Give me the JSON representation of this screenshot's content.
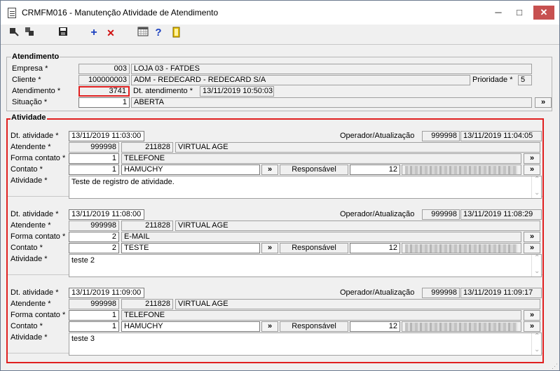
{
  "window": {
    "title": "CRMFM016 - Manutenção Atividade de Atendimento",
    "min": "─",
    "max": "□",
    "close": "✕"
  },
  "toolbar": [
    "nav-icon",
    "nav2-icon",
    "save-icon",
    "add-icon",
    "delete-icon",
    "calendar-icon",
    "help-icon",
    "exit-icon"
  ],
  "toolbar_glyphs": {
    "add": "+",
    "delete": "✕",
    "help": "?"
  },
  "atendimento": {
    "legend": "Atendimento",
    "empresa_label": "Empresa *",
    "empresa_code": "003",
    "empresa_name": "LOJA 03 - FATDES",
    "cliente_label": "Cliente *",
    "cliente_code": "100000003",
    "cliente_name": "ADM - REDECARD - REDECARD S/A",
    "prioridade_label": "Prioridade *",
    "prioridade": "5",
    "atendimento_label": "Atendimento *",
    "atendimento": "3741",
    "dt_label": "Dt. atendimento *",
    "dt": "13/11/2019 10:50:03",
    "situacao_label": "Situação *",
    "situacao_code": "1",
    "situacao_name": "ABERTA"
  },
  "atividade": {
    "legend": "Atividade",
    "labels": {
      "dt": "Dt. atividade *",
      "atendente": "Atendente *",
      "forma": "Forma contato *",
      "contato": "Contato *",
      "atividade": "Atividade *",
      "operador": "Operador/Atualização",
      "responsavel": "Responsável"
    },
    "btn": "»",
    "items": [
      {
        "dt": "13/11/2019 11:03:00",
        "op_code": "999998",
        "op_dt": "13/11/2019 11:04:05",
        "atend_code": "999998",
        "atend_id": "211828",
        "atend_name": "VIRTUAL AGE",
        "forma_code": "1",
        "forma_name": "TELEFONE",
        "contato_code": "1",
        "contato_name": "HAMUCHY",
        "resp_code": "12",
        "texto": "Teste de registro de atividade."
      },
      {
        "dt": "13/11/2019 11:08:00",
        "op_code": "999998",
        "op_dt": "13/11/2019 11:08:29",
        "atend_code": "999998",
        "atend_id": "211828",
        "atend_name": "VIRTUAL AGE",
        "forma_code": "2",
        "forma_name": "E-MAIL",
        "contato_code": "2",
        "contato_name": "TESTE",
        "resp_code": "12",
        "texto": "teste 2"
      },
      {
        "dt": "13/11/2019 11:09:00",
        "op_code": "999998",
        "op_dt": "13/11/2019 11:09:17",
        "atend_code": "999998",
        "atend_id": "211828",
        "atend_name": "VIRTUAL AGE",
        "forma_code": "1",
        "forma_name": "TELEFONE",
        "contato_code": "1",
        "contato_name": "HAMUCHY",
        "resp_code": "12",
        "texto": "teste 3"
      }
    ]
  }
}
